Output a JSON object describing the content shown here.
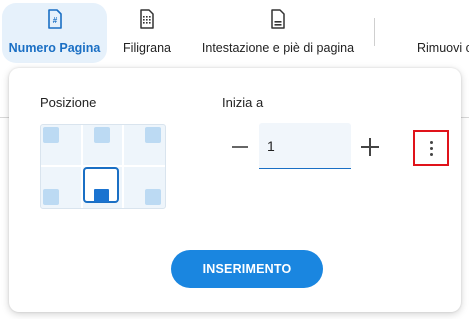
{
  "toolbar": {
    "items": [
      {
        "label": "Numero Pagina",
        "icon": "page-number-icon",
        "active": true
      },
      {
        "label": "Filigrana",
        "icon": "watermark-icon",
        "active": false
      },
      {
        "label": "Intestazione e piè di pagina",
        "icon": "header-footer-icon",
        "active": false
      },
      {
        "label": "Rimuovi c",
        "icon": "",
        "active": false
      }
    ]
  },
  "panel": {
    "position_label": "Posizione",
    "start_label": "Inizia a",
    "start_value": "1",
    "insert_button": "INSERIMENTO"
  },
  "colors": {
    "accent": "#1a86e0",
    "active_tab_bg": "#e6f1fb",
    "highlight_border": "#e0131a"
  }
}
